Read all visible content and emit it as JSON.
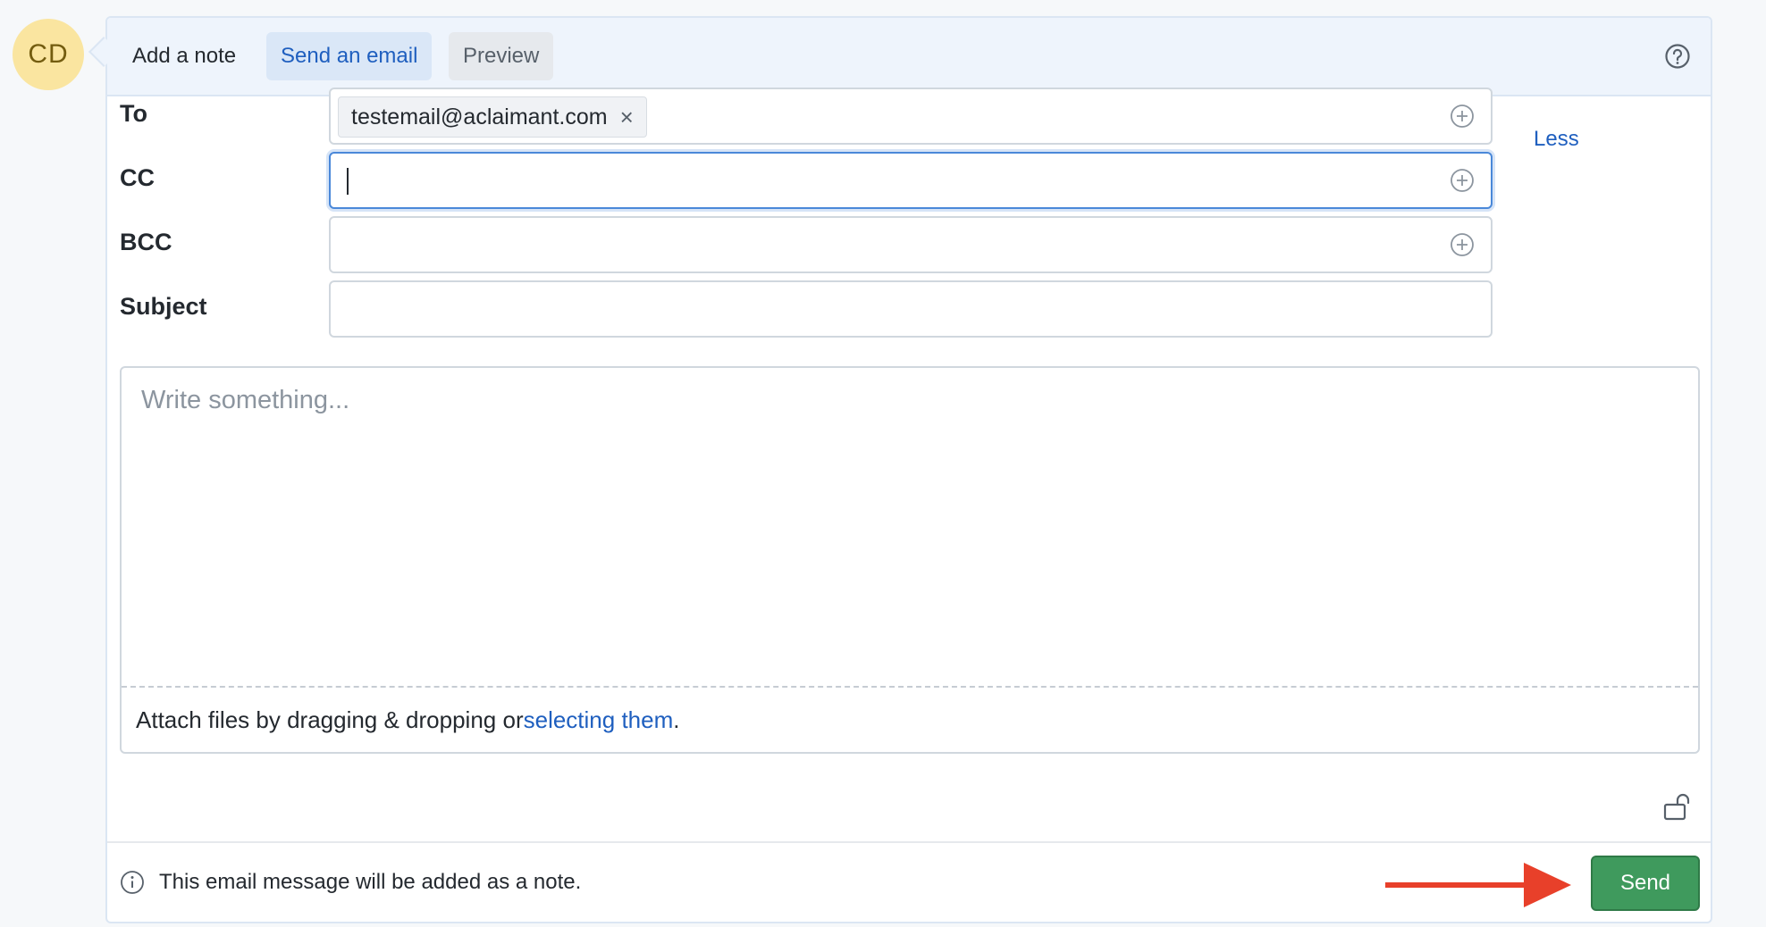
{
  "avatar": {
    "initials": "CD"
  },
  "tabs": [
    {
      "label": "Add a note"
    },
    {
      "label": "Send an email"
    },
    {
      "label": "Preview"
    }
  ],
  "form": {
    "to_label": "To",
    "to_recipient": "testemail@aclaimant.com",
    "remove_glyph": "×",
    "cc_label": "CC",
    "bcc_label": "BCC",
    "subject_label": "Subject",
    "subject_value": "",
    "less_label": "Less"
  },
  "editor": {
    "placeholder": "Write something...",
    "attach_prefix": "Attach files by dragging & dropping or ",
    "attach_link": "selecting them",
    "attach_suffix": "."
  },
  "footer": {
    "note": "This email message will be added as a note.",
    "send_label": "Send"
  },
  "colors": {
    "accent": "#1f5fbf",
    "send": "#3f9a5d",
    "arrow": "#e8402a",
    "avatar": "#fae5a0"
  }
}
